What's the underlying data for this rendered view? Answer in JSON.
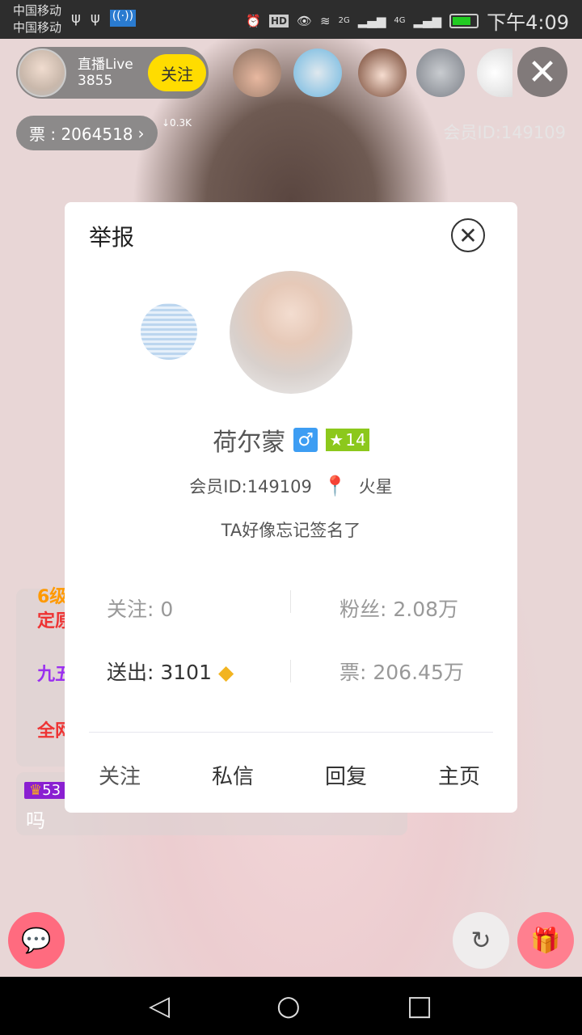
{
  "status_bar": {
    "carrier1": "中国移动",
    "carrier2": "中国移动",
    "net1": "2G",
    "net2": "4G",
    "time": "下午4:09"
  },
  "host": {
    "name": "直播Live",
    "count": "3855",
    "follow_label": "关注"
  },
  "votes": {
    "label": "票 : 2064518",
    "delta": "↓0.3K"
  },
  "member_id_overlay": "会员ID:149109",
  "chat": {
    "lines": [
      "6级",
      "定原",
      "九五",
      "全网"
    ],
    "badge": "53",
    "message": "吗"
  },
  "dialog": {
    "title": "举报",
    "username": "荷尔蒙",
    "gender_icon": "♂",
    "level": "14",
    "member_id": "会员ID:149109",
    "location": "火星",
    "signature": "TA好像忘记签名了",
    "following": "关注: 0",
    "fans": "粉丝: 2.08万",
    "sent": "送出: 3101",
    "tickets": "票: 206.45万",
    "actions": [
      "关注",
      "私信",
      "回复",
      "主页"
    ]
  },
  "colors": {
    "follow": "#ffdc00",
    "male": "#3d9df3",
    "level": "#8cc81c",
    "chat_fab": "#ff6b7f"
  }
}
